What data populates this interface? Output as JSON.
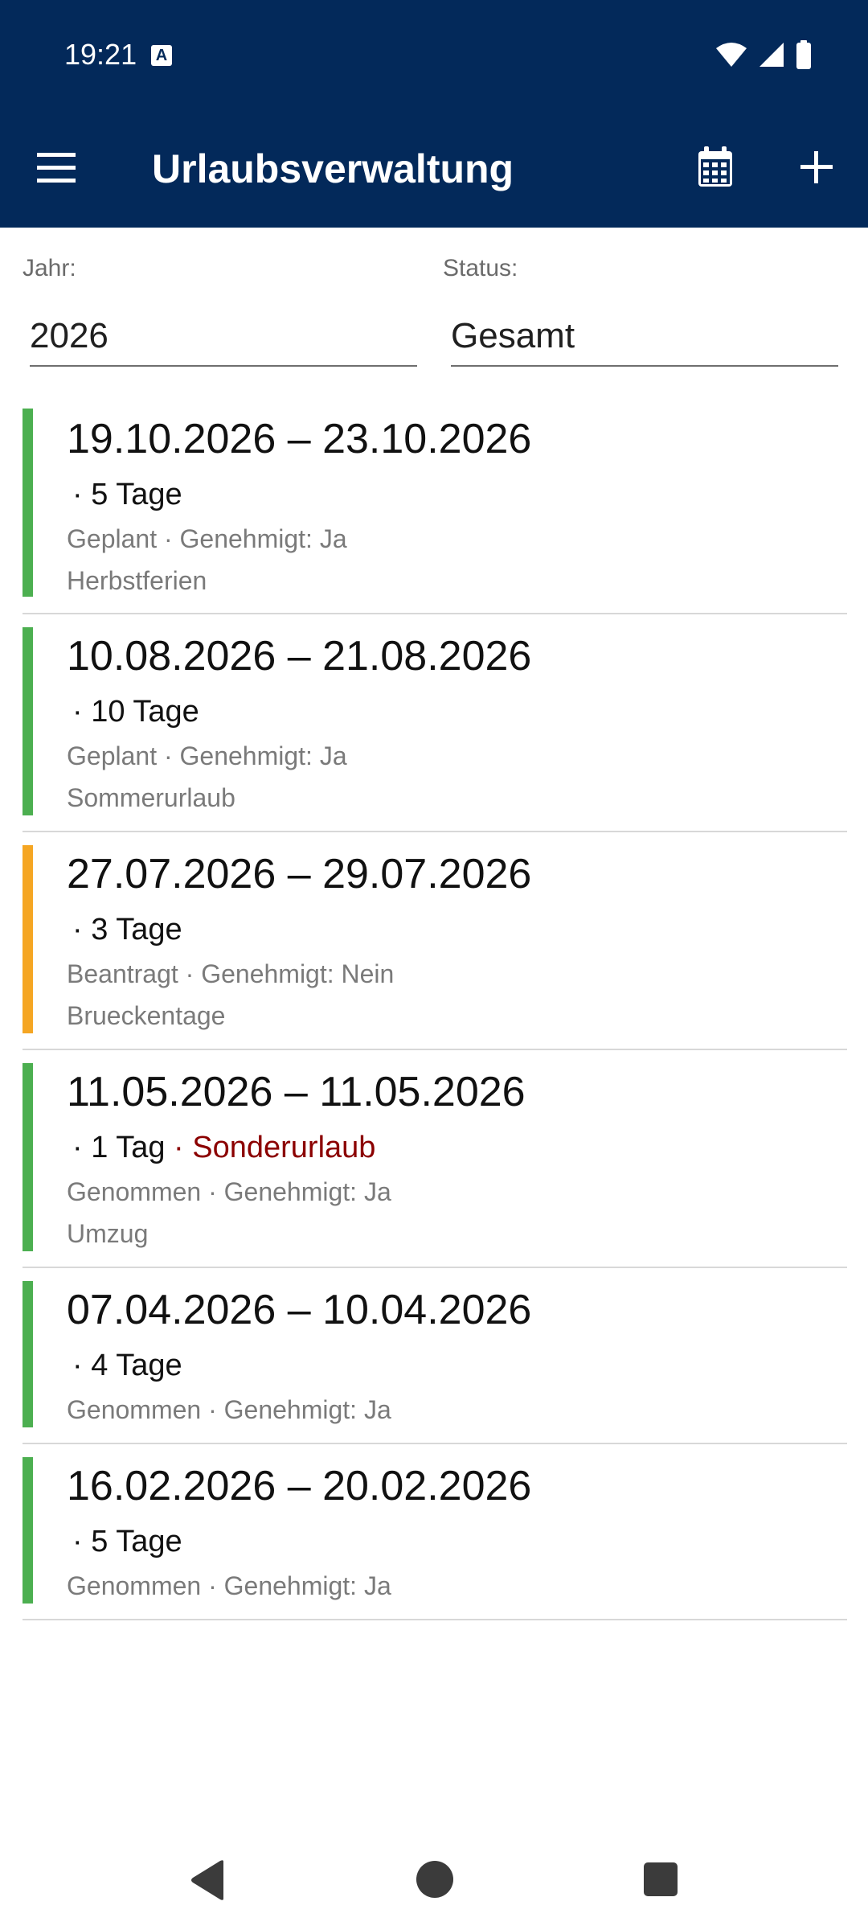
{
  "status_bar": {
    "time": "19:21",
    "notification_icon": "a-icon",
    "icons": [
      "wifi-icon",
      "signal-icon",
      "battery-icon"
    ]
  },
  "app_bar": {
    "title": "Urlaubsverwaltung",
    "menu_icon": "menu-icon",
    "calendar_icon": "calendar-icon",
    "add_icon": "add-icon"
  },
  "filters": {
    "year_label": "Jahr:",
    "year_value": "2026",
    "status_label": "Status:",
    "status_value": "Gesamt"
  },
  "colors": {
    "primary": "#03295a",
    "approved": "#4caf50",
    "requested": "#f5a623",
    "special_leave": "#8b0000"
  },
  "entries": [
    {
      "date_range": "19.10.2026 – 23.10.2026",
      "days": " · 5 Tage",
      "special": "",
      "meta": "Geplant · Genehmigt: Ja",
      "note": "Herbstferien",
      "status_color": "#4caf50"
    },
    {
      "date_range": "10.08.2026 – 21.08.2026",
      "days": " · 10 Tage",
      "special": "",
      "meta": "Geplant · Genehmigt: Ja",
      "note": "Sommerurlaub",
      "status_color": "#4caf50"
    },
    {
      "date_range": "27.07.2026 – 29.07.2026",
      "days": " · 3 Tage",
      "special": "",
      "meta": "Beantragt · Genehmigt: Nein",
      "note": "Brueckentage",
      "status_color": "#f5a623"
    },
    {
      "date_range": "11.05.2026 – 11.05.2026",
      "days": " · 1 Tag",
      "special": " · Sonderurlaub",
      "meta": "Genommen · Genehmigt: Ja",
      "note": "Umzug",
      "status_color": "#4caf50"
    },
    {
      "date_range": "07.04.2026 – 10.04.2026",
      "days": " · 4 Tage",
      "special": "",
      "meta": "Genommen · Genehmigt: Ja",
      "note": "",
      "status_color": "#4caf50"
    },
    {
      "date_range": "16.02.2026 – 20.02.2026",
      "days": " · 5 Tage",
      "special": "",
      "meta": "Genommen · Genehmigt: Ja",
      "note": "",
      "status_color": "#4caf50"
    }
  ],
  "nav_bar": {
    "back_icon": "back-icon",
    "home_icon": "home-icon",
    "recents_icon": "recents-icon"
  }
}
